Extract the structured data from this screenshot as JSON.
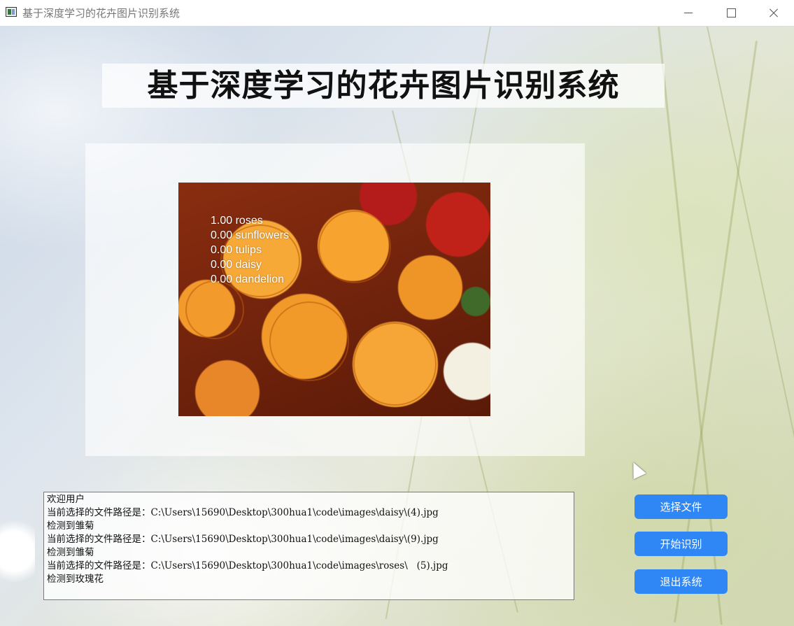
{
  "window": {
    "title": "基于深度学习的花卉图片识别系统",
    "controls": [
      "minimize-icon",
      "maximize-icon",
      "close-icon"
    ]
  },
  "header": {
    "title": "基于深度学习的花卉图片识别系统"
  },
  "image_panel": {
    "predictions": [
      "1.00 roses",
      "0.00 sunflowers",
      "0.00 tulips",
      "0.00 daisy",
      "0.00 dandelion"
    ]
  },
  "log": {
    "lines": [
      "欢迎用户",
      "当前选择的文件路径是：C:\\Users\\15690\\Desktop\\300hua1\\code\\images\\daisy\\(4).jpg",
      "检测到雏菊",
      "当前选择的文件路径是：C:\\Users\\15690\\Desktop\\300hua1\\code\\images\\daisy\\(9).jpg",
      "检测到雏菊",
      "当前选择的文件路径是：C:\\Users\\15690\\Desktop\\300hua1\\code\\images\\roses\\   (5).jpg",
      "检测到玫瑰花"
    ]
  },
  "buttons": {
    "select_file": "选择文件",
    "start_recognition": "开始识别",
    "exit_system": "退出系统"
  },
  "colors": {
    "button_bg": "#2f86f5",
    "button_text": "#ffffff"
  }
}
